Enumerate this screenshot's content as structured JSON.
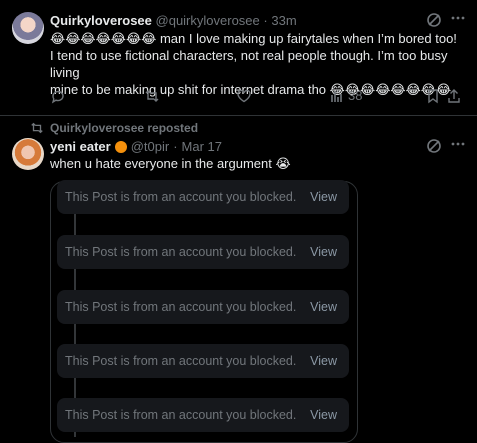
{
  "post1": {
    "display_name": "Quirkyloverosee",
    "handle": "@quirkyloverosee",
    "sep": "·",
    "time": "33m",
    "line_a": "😂😂😂😂😂😂😂 man I love making up fairytales when I’m bored too!",
    "line_b": "I tend to use fictional characters, not real people though. I’m too busy living",
    "line_c": "mine to be making up shit for internet drama tho 😂😂😂😂😂😂😂😂",
    "views": "38",
    "icons": [
      "grok-icon",
      "more-icon",
      "reply-icon",
      "repost-icon",
      "like-icon",
      "views-icon",
      "bookmark-icon",
      "share-icon"
    ]
  },
  "repost_note": "Quirkyloverosee reposted",
  "post2": {
    "display_name": "yeni eater",
    "handle": "@t0pir",
    "sep": "·",
    "time": "Mar 17",
    "text": "when u hate everyone in the argument 😭",
    "badge_color": "#f4900c"
  },
  "blocked_items": [
    {
      "message": "This Post is from an account you blocked.",
      "action": "View"
    },
    {
      "message": "This Post is from an account you blocked.",
      "action": "View"
    },
    {
      "message": "This Post is from an account you blocked.",
      "action": "View"
    },
    {
      "message": "This Post is from an account you blocked.",
      "action": "View"
    },
    {
      "message": "This Post is from an account you blocked.",
      "action": "View"
    }
  ]
}
